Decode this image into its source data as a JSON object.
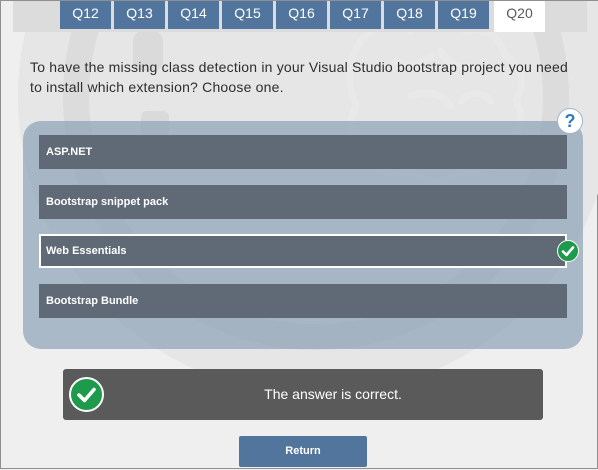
{
  "tabs": [
    {
      "label": "Q12"
    },
    {
      "label": "Q13"
    },
    {
      "label": "Q14"
    },
    {
      "label": "Q15"
    },
    {
      "label": "Q16"
    },
    {
      "label": "Q17"
    },
    {
      "label": "Q18"
    },
    {
      "label": "Q19"
    },
    {
      "label": "Q20"
    }
  ],
  "active_tab": "Q20",
  "question": {
    "text": "To have the missing class detection in your Visual Studio bootstrap project you need to install which extension? Choose one."
  },
  "help": {
    "label": "?",
    "icon": "question-mark-icon"
  },
  "options": [
    {
      "label": "ASP.NET"
    },
    {
      "label": "Bootstrap snippet pack"
    },
    {
      "label": "Web Essentials"
    },
    {
      "label": "Bootstrap Bundle"
    }
  ],
  "selected_option": "Web Essentials",
  "result": {
    "message": "The answer is correct.",
    "icon": "checkmark-icon",
    "status_color": "#1e9a4c"
  },
  "return_button": {
    "label": "Return"
  },
  "colors": {
    "accent": "#51759d",
    "option_bg": "#5f6a76",
    "success": "#1e9a4c"
  }
}
